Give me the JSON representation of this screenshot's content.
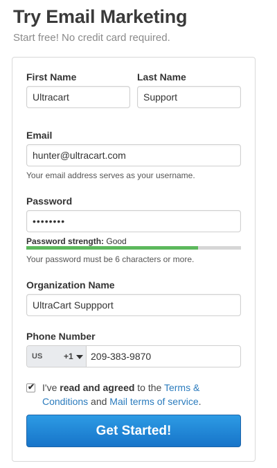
{
  "header": {
    "title": "Try Email Marketing",
    "subtitle": "Start free! No credit card required."
  },
  "form": {
    "first_name": {
      "label": "First Name",
      "value": "Ultracart"
    },
    "last_name": {
      "label": "Last Name",
      "value": "Support"
    },
    "email": {
      "label": "Email",
      "value": "hunter@ultracart.com",
      "help": "Your email address serves as your username."
    },
    "password": {
      "label": "Password",
      "value": "12345678",
      "strength_label": "Password strength:",
      "strength_value": "Good",
      "strength_fraction": 0.8,
      "strength_color": "#5cb85c",
      "help": "Your password must be 6 characters or more."
    },
    "organization": {
      "label": "Organization Name",
      "value": "UltraCart Suppport"
    },
    "phone": {
      "label": "Phone Number",
      "country_code": "US",
      "dial_code": "+1",
      "number": "209-383-9870"
    },
    "agree": {
      "checked": true,
      "text_pre": "I've ",
      "text_bold": "read and agreed",
      "text_mid": " to the ",
      "link_terms": "Terms & Conditions",
      "text_and": " and ",
      "link_mail_terms": "Mail terms of service",
      "text_end": "."
    },
    "submit_label": "Get Started!"
  },
  "colors": {
    "accent": "#1774c9",
    "link": "#2a7bbd"
  }
}
